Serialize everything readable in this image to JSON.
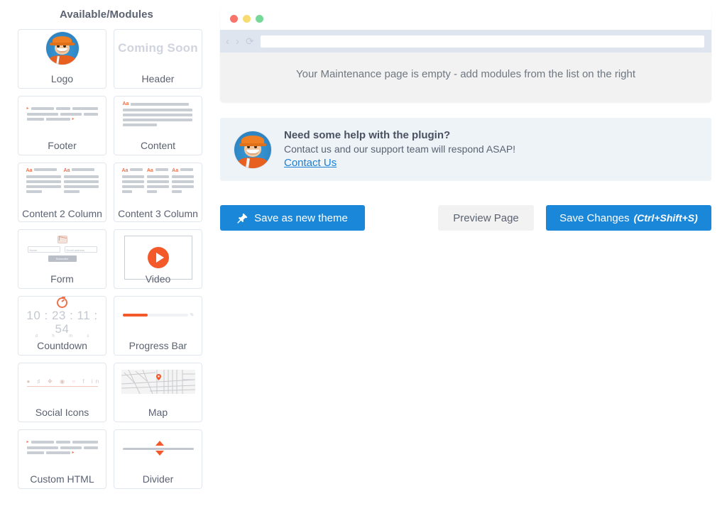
{
  "sidebar": {
    "title": "Available/Modules",
    "modules": [
      {
        "label": "Logo",
        "thumb": "mascot-avatar"
      },
      {
        "label": "Header",
        "thumb": "coming-soon-text",
        "thumb_text": "Coming Soon"
      },
      {
        "label": "Footer",
        "thumb": "text-lines"
      },
      {
        "label": "Content",
        "thumb": "content-lines",
        "thumb_text": "Aa"
      },
      {
        "label": "Content 2 Column",
        "thumb": "content-2col",
        "thumb_text": "Aa"
      },
      {
        "label": "Content 3 Column",
        "thumb": "content-3col",
        "thumb_text": "Aa"
      },
      {
        "label": "Form",
        "thumb": "form-preview",
        "field_1": "Name",
        "field_2": "Email address",
        "submit_label": "Subscribe"
      },
      {
        "label": "Video",
        "thumb": "video-play"
      },
      {
        "label": "Countdown",
        "thumb": "countdown-timer",
        "digits": "10 : 23 : 11 : 54",
        "units": [
          "d",
          "h",
          "m",
          "s"
        ]
      },
      {
        "label": "Progress Bar",
        "thumb": "progress-bar",
        "percent": 38
      },
      {
        "label": "Social Icons",
        "thumb": "social-icons"
      },
      {
        "label": "Map",
        "thumb": "map-preview"
      },
      {
        "label": "Custom HTML",
        "thumb": "text-lines"
      },
      {
        "label": "Divider",
        "thumb": "divider-arrows"
      }
    ]
  },
  "preview": {
    "url_value": "",
    "url_placeholder": "",
    "empty_message": "Your Maintenance page is empty - add modules from the list on the right",
    "window_dots": [
      "red",
      "yellow",
      "green"
    ],
    "nav": {
      "back": "‹",
      "forward": "›",
      "reload": "⟳"
    }
  },
  "help": {
    "heading": "Need some help with the plugin?",
    "subtext": "Contact us and our support team will respond ASAP!",
    "link_label": "Contact Us"
  },
  "actions": {
    "save_theme_label": "Save as new theme",
    "preview_label": "Preview Page",
    "save_changes_label": "Save Changes",
    "save_changes_shortcut": "(Ctrl+Shift+S)"
  },
  "colors": {
    "primary_blue": "#1b87d9",
    "accent_orange": "#f4592a",
    "link_blue": "#1b7fd4",
    "panel_bg": "#eef3f8",
    "browser_chrome": "#dfe5ef",
    "text_gray": "#5b6271"
  }
}
